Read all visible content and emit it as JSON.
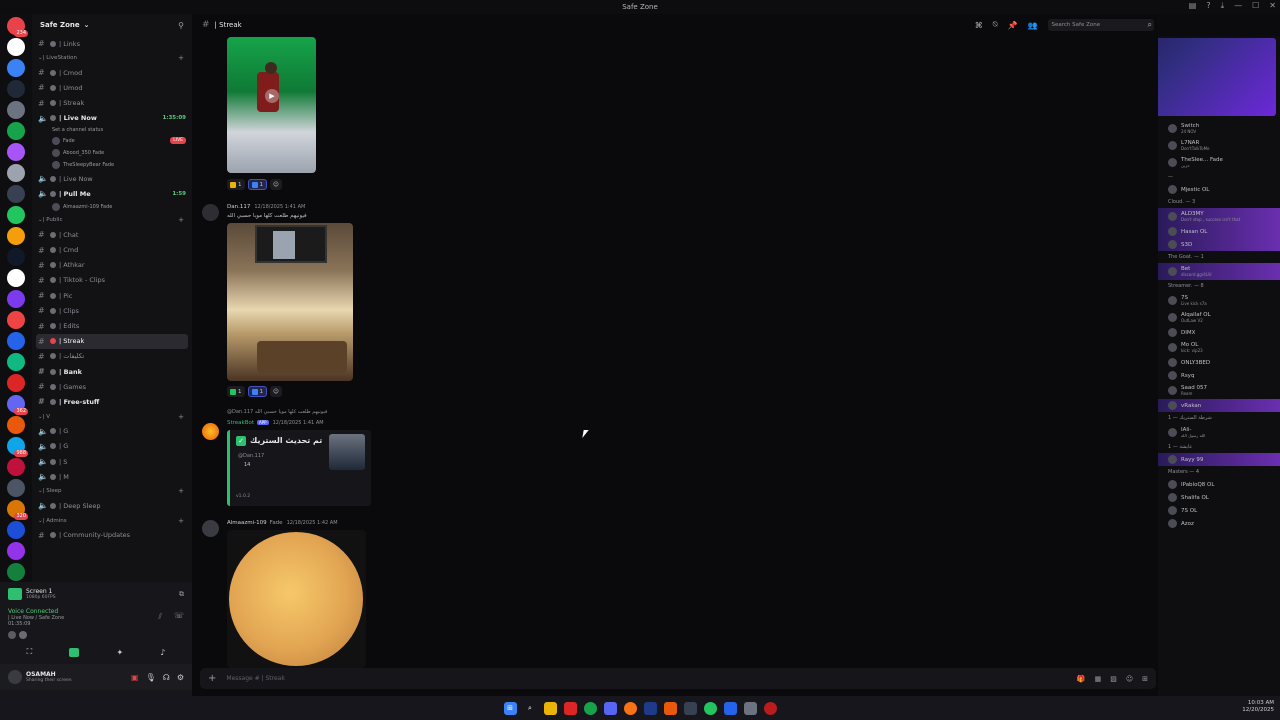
{
  "window": {
    "title": "Safe Zone"
  },
  "rail": {
    "badges": [
      "234",
      "362",
      "988",
      "320"
    ]
  },
  "guild": {
    "name": "Safe Zone"
  },
  "channels": [
    {
      "type": "text",
      "label": "| Links"
    },
    {
      "type": "cat",
      "label": "| LiveStation"
    },
    {
      "type": "text",
      "label": "| Cmod"
    },
    {
      "type": "text",
      "label": "| Umod"
    },
    {
      "type": "text",
      "label": "| Streak"
    },
    {
      "type": "voice",
      "label": "| Live Now",
      "bright": true,
      "time": "1:35:09",
      "status": "Set a channel status"
    },
    {
      "type": "vuser",
      "label": "Fade",
      "live": "LIVE"
    },
    {
      "type": "vuser",
      "label": "Abood_350 Fade"
    },
    {
      "type": "vuser",
      "label": "TheSleepyBear Fade"
    },
    {
      "type": "voice",
      "label": "| Live Now"
    },
    {
      "type": "voice",
      "label": "| Pull Me",
      "bright": true,
      "time": "1:59"
    },
    {
      "type": "vuser",
      "label": "Almaazmi-109 Fade"
    },
    {
      "type": "cat",
      "label": "| Public"
    },
    {
      "type": "text",
      "label": "| Chat"
    },
    {
      "type": "text",
      "label": "| Cmd"
    },
    {
      "type": "text",
      "label": "| Athkar"
    },
    {
      "type": "text",
      "label": "| Tiktok - Clips"
    },
    {
      "type": "text",
      "label": "| Pic"
    },
    {
      "type": "text",
      "label": "| Clips"
    },
    {
      "type": "text",
      "label": "| Edits"
    },
    {
      "type": "text",
      "label": "| Streak",
      "active": true
    },
    {
      "type": "text",
      "label": "| تكليفات"
    },
    {
      "type": "text",
      "label": "| Bank",
      "bright": true
    },
    {
      "type": "text",
      "label": "| Games"
    },
    {
      "type": "text",
      "label": "| Free-stuff",
      "bright": true
    },
    {
      "type": "cat",
      "label": "| V"
    },
    {
      "type": "voice",
      "label": "| G"
    },
    {
      "type": "voice",
      "label": "| G"
    },
    {
      "type": "voice",
      "label": "| S"
    },
    {
      "type": "voice",
      "label": "| M"
    },
    {
      "type": "cat",
      "label": "| Sleep"
    },
    {
      "type": "voice",
      "label": "| Deep Sleep"
    },
    {
      "type": "cat",
      "label": "| Admins"
    },
    {
      "type": "text",
      "label": "| Community-Updates"
    }
  ],
  "user_panel": {
    "screen_title": "Screen 1",
    "screen_sub": "1080p 60FPS",
    "voice_status": "Voice Connected",
    "voice_channel": "| Live Now / Safe Zone",
    "voice_time": "01:35:09",
    "username": "OSAMAH",
    "user_status": "Sharing their screen"
  },
  "chat": {
    "channel_name": "| Streak",
    "search_placeholder": "Search Safe Zone",
    "composer_placeholder": "Message # | Streak",
    "messages": [
      {
        "reactions": [
          {
            "emoji": "warn",
            "count": "1"
          },
          {
            "emoji": "flag",
            "count": "1",
            "me": true
          }
        ]
      },
      {
        "author": "Dan.117",
        "timestamp": "12/18/2025 1:41 AM",
        "text": "فيونيهم طلعت كلها موبا حسبي الله",
        "reactions": [
          {
            "emoji": "check",
            "count": "1"
          },
          {
            "emoji": "flag",
            "count": "1",
            "me": true
          }
        ]
      },
      {
        "reply": "@Dan.117 فيونيهم طلعت كلها موبا حسبي الله",
        "author": "StreakBot",
        "app": "APP",
        "timestamp": "12/18/2025 1:41 AM",
        "embed_title": "تم تحديث الستريك",
        "embed_mention": "@Dan.117",
        "embed_count": "14",
        "embed_footer": "v1.0.2"
      },
      {
        "author": "Almaazmi-109",
        "tag": "Fade",
        "timestamp": "12/18/2025 1:42 AM"
      }
    ]
  },
  "members": {
    "rows": [
      {
        "name": "Switch",
        "sub": "24 NOV"
      },
      {
        "name": "L7NAR",
        "sub": "Don'tTalkToMe"
      },
      {
        "name": "TheSlee... Fade",
        "sub": "حزين"
      },
      {
        "group": "—"
      },
      {
        "name": "Mjestic OL"
      },
      {
        "group": "Cloud. — 3"
      },
      {
        "name": "ALD3MY",
        "sub": "Don't stop , success isn't that",
        "hl": true
      },
      {
        "name": "Hasan OL",
        "hl": true
      },
      {
        "name": "S3D",
        "hl": true
      },
      {
        "group": "The Goat. — 1"
      },
      {
        "name": "Bet",
        "sub": "discord.gg/4UU",
        "hl": true
      },
      {
        "group": "Streamer. — 8"
      },
      {
        "name": "7S",
        "sub": "Live kick s7a"
      },
      {
        "name": "Alqallaf OL",
        "sub": "OutLaw V2"
      },
      {
        "name": "DIMX"
      },
      {
        "name": "Mo OL",
        "sub": "kick: vip23"
      },
      {
        "name": "ONLY3BED"
      },
      {
        "name": "Rsyq"
      },
      {
        "name": "Saad 057",
        "sub": "Ream"
      },
      {
        "name": "vRakan",
        "hl": true
      },
      {
        "group": "شرطة الستريك — 1"
      },
      {
        "name": "IAli-",
        "sub": "الله رسول الله"
      },
      {
        "group": "عايشة — 1"
      },
      {
        "name": "Rayy 99",
        "hl": true
      },
      {
        "group": "Masters — 4"
      },
      {
        "name": "IPabloQ8 OL"
      },
      {
        "name": "Shalifa OL"
      },
      {
        "name": "7S OL"
      },
      {
        "name": "Azoz"
      }
    ]
  },
  "taskbar": {
    "time": "10:03 AM",
    "date": "12/20/2025"
  }
}
